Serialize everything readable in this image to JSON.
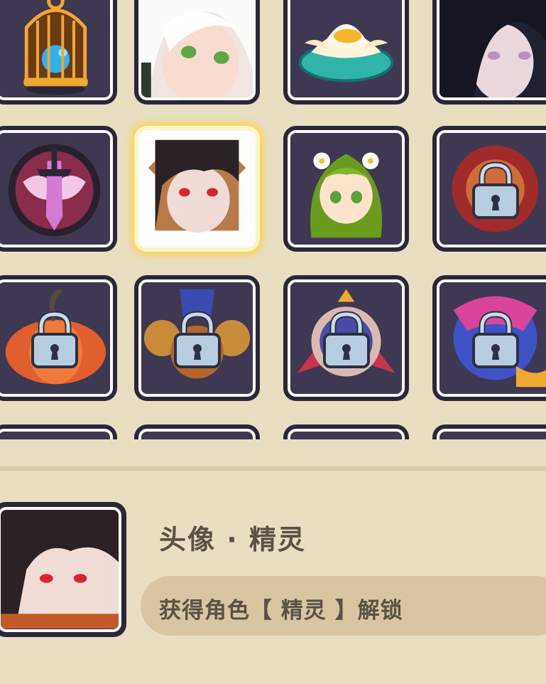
{
  "grid": {
    "items": [
      {
        "icon": "bird-cage-icon",
        "locked": false
      },
      {
        "icon": "white-hair-girl-portrait",
        "locked": false
      },
      {
        "icon": "lotus-flower-icon",
        "locked": false
      },
      {
        "icon": "dark-hair-girl-portrait",
        "locked": false
      },
      {
        "icon": "sword-emblem-icon",
        "locked": false
      },
      {
        "icon": "black-hair-red-eyes-portrait",
        "locked": false,
        "selected": true
      },
      {
        "icon": "green-hair-elf-icon",
        "locked": false
      },
      {
        "icon": "red-medallion-icon",
        "locked": true
      },
      {
        "icon": "pumpkin-icon",
        "locked": true
      },
      {
        "icon": "golden-horn-icon",
        "locked": true
      },
      {
        "icon": "ribbon-badge-icon",
        "locked": true
      },
      {
        "icon": "fan-emblem-icon",
        "locked": true
      }
    ]
  },
  "detail": {
    "title": "头像 · 精灵",
    "unlock_condition": "获得角色【 精灵 】解锁"
  }
}
